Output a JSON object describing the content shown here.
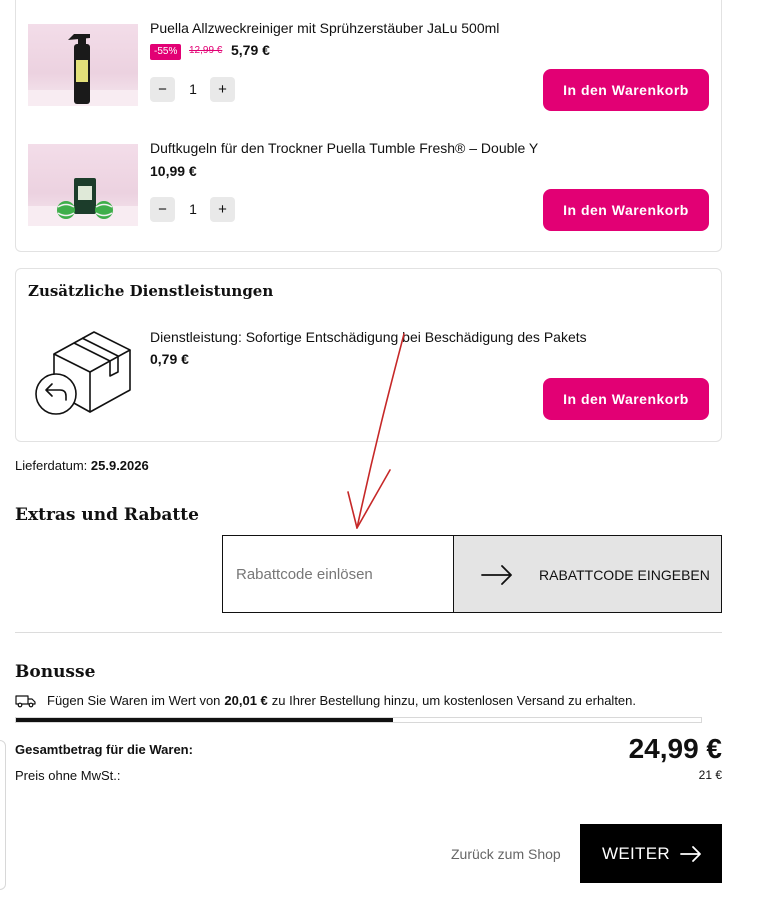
{
  "products": [
    {
      "name": "Puella Allzweckreiniger mit Sprühzerstäuber JaLu 500ml",
      "discount_badge": "-55%",
      "old_price": "12,99 €",
      "price": "5,79 €",
      "quantity": "1",
      "cart_label": "In den Warenkorb"
    },
    {
      "name": "Duftkugeln für den Trockner Puella Tumble Fresh® – Double Y",
      "price": "10,99 €",
      "quantity": "1",
      "cart_label": "In den Warenkorb"
    }
  ],
  "quantity_controls": {
    "minus": "−",
    "plus": "+"
  },
  "services": {
    "heading": "Zusätzliche Dienstleistungen",
    "item_name": "Dienstleistung: Sofortige Entschädigung bei Beschädigung des Pakets",
    "item_price": "0,79 €",
    "cart_label": "In den Warenkorb"
  },
  "delivery": {
    "label": "Lieferdatum:",
    "date": "25.9.2026"
  },
  "extras": {
    "heading": "Extras und Rabatte",
    "coupon_placeholder": "Rabattcode einlösen",
    "coupon_button": "RABATTCODE EINGEBEN"
  },
  "bonuses": {
    "heading": "Bonusse",
    "text_before": "Fügen Sie Waren im Wert von",
    "amount": "20,01 €",
    "text_after": "zu Ihrer Bestellung hinzu, um kostenlosen Versand zu erhalten.",
    "progress_fraction": 0.55
  },
  "totals": {
    "total_label": "Gesamtbetrag für die Waren:",
    "total_value": "24,99 €",
    "net_label": "Preis ohne MwSt.:",
    "net_value": "21 €"
  },
  "footer": {
    "back_label": "Zurück zum Shop",
    "next_label": "WEITER"
  },
  "colors": {
    "accent": "#e20074",
    "primary_button": "#000000",
    "coupon_button_bg": "#e4e4e4",
    "annotation": "#c62828"
  },
  "icons": [
    "spray-bottle-image",
    "dryer-balls-image",
    "parcel-return-icon",
    "arrow-right-icon",
    "truck-icon"
  ]
}
